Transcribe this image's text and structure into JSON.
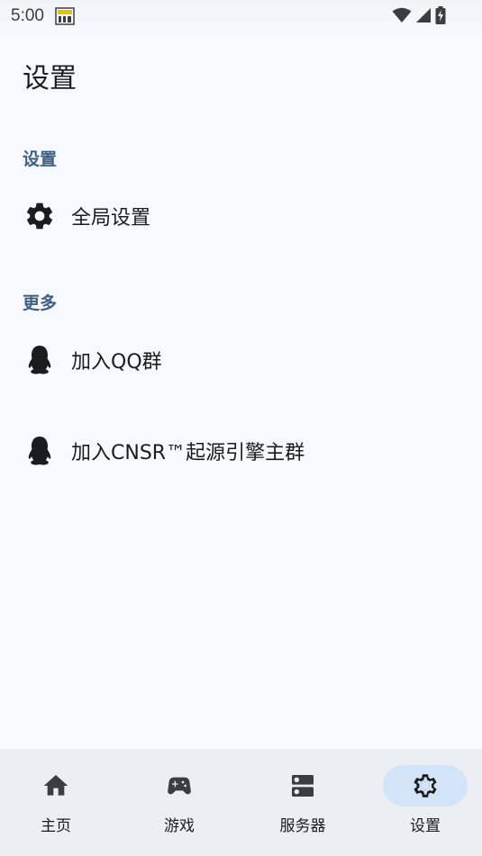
{
  "status_bar": {
    "time": "5:00"
  },
  "page": {
    "title": "设置"
  },
  "sections": [
    {
      "header": "设置",
      "items": [
        {
          "label": "全局设置",
          "icon": "gear-icon"
        }
      ]
    },
    {
      "header": "更多",
      "items": [
        {
          "label": "加入QQ群",
          "icon": "qq-penguin-icon"
        },
        {
          "label": "加入CNSR™起源引擎主群",
          "icon": "qq-penguin-icon"
        }
      ]
    }
  ],
  "bottom_nav": {
    "items": [
      {
        "label": "主页",
        "icon": "home-icon",
        "active": false
      },
      {
        "label": "游戏",
        "icon": "gamepad-icon",
        "active": false
      },
      {
        "label": "服务器",
        "icon": "server-icon",
        "active": false
      },
      {
        "label": "设置",
        "icon": "gear-icon",
        "active": true
      }
    ]
  },
  "colors": {
    "background": "#f8f9ff",
    "section_header": "#3c5f85",
    "nav_background": "#eceef4",
    "nav_active_pill": "#d3e4f8"
  }
}
